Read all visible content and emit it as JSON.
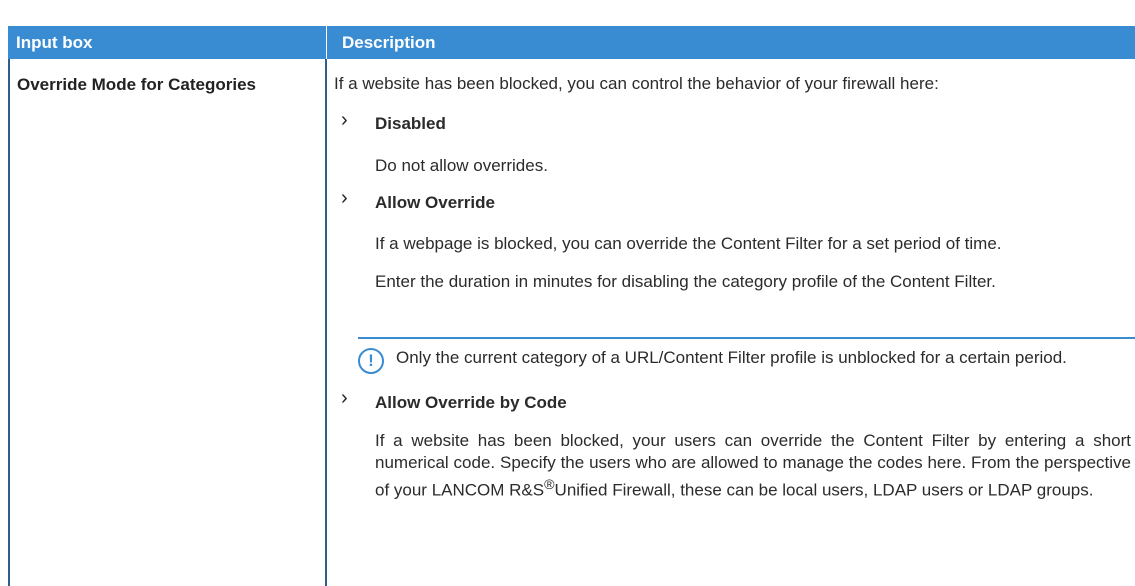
{
  "table": {
    "header": {
      "col1": "Input box",
      "col2": "Description"
    },
    "term": "Override Mode for Categories",
    "intro": "If a website has been blocked, you can control the behavior of your firewall here:",
    "options": [
      {
        "title": "Disabled",
        "text": "Do not allow overrides."
      },
      {
        "title": "Allow Override",
        "text1": "If a webpage is blocked, you can override the Content Filter for a set period of time.",
        "text2": "Enter the duration in minutes for disabling the category profile of the Content Filter.",
        "note": "Only the current category of a URL/Content Filter profile is unblocked for a certain period."
      },
      {
        "title": "Allow Override by Code",
        "text_before_brand": "If a website has been blocked, your users can override the Content Filter by entering a short numerical code. Specify the users who are allowed to manage the codes here. From the perspective of your LANCOM R&S",
        "registered": "®",
        "text_after_brand": "Unified Firewall, these can be local users, LDAP users or LDAP groups."
      }
    ]
  },
  "colors": {
    "header_bg": "#3a8cd2",
    "accent": "#3a8cd2",
    "border": "#2e5f8a"
  },
  "icons": {
    "note": "info-exclamation-icon",
    "bullet": "chevron-right-icon"
  }
}
